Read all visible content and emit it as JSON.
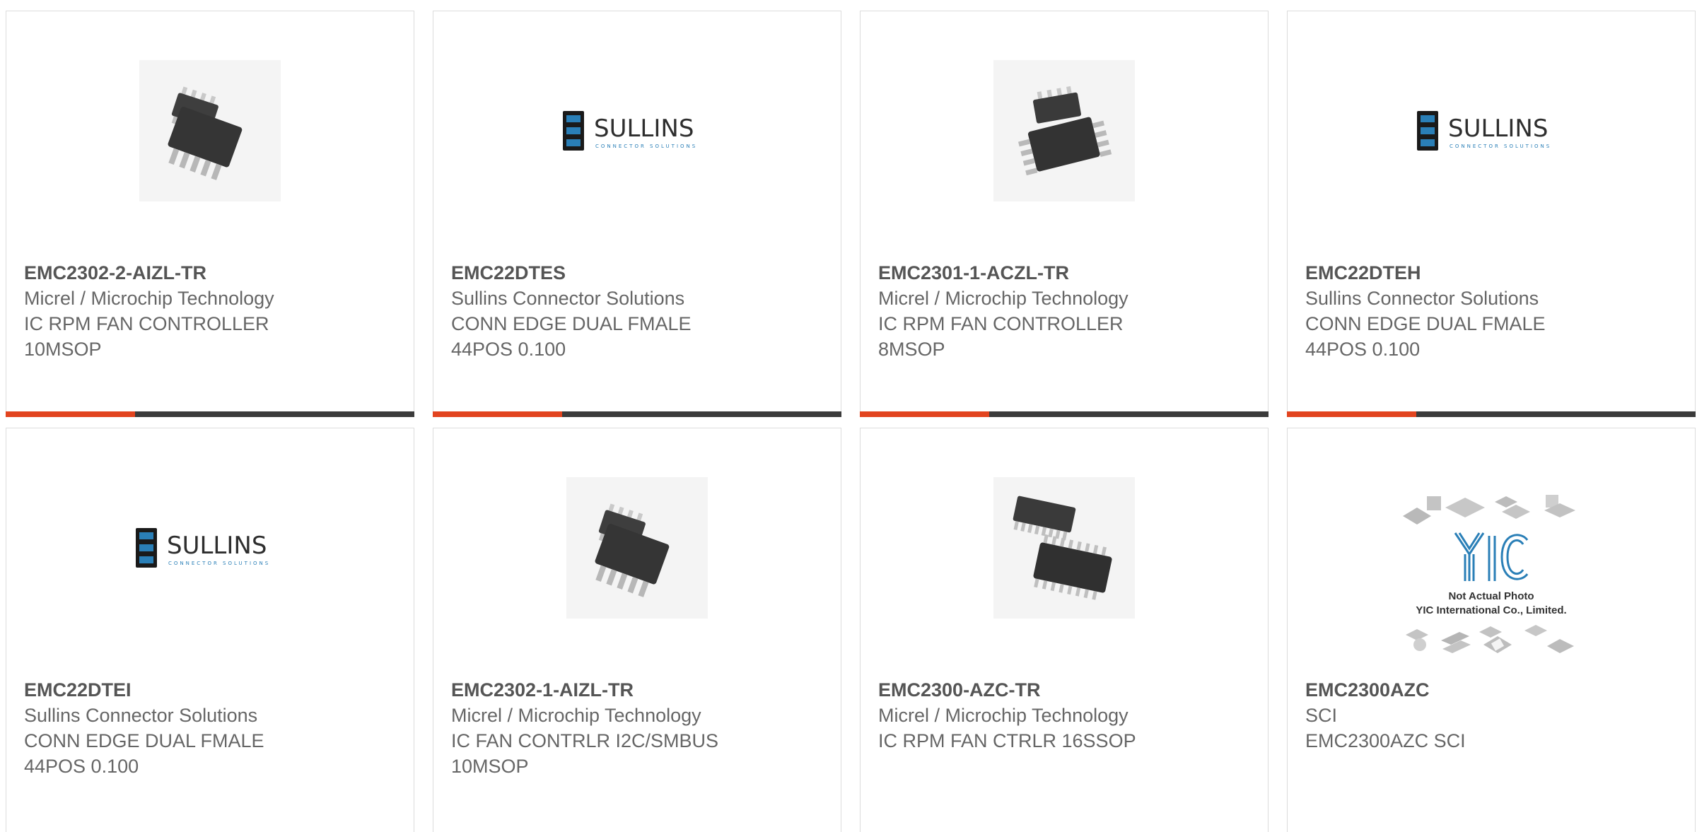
{
  "colors": {
    "accent_orange": "#e2441f",
    "bar_dark": "#3b3b3b",
    "sullins_blue": "#2a7fb7"
  },
  "products": [
    {
      "part": "EMC2302-2-AIZL-TR",
      "maker": "Micrel / Microchip Technology",
      "desc1": "IC RPM FAN CONTROLLER",
      "desc2": "10MSOP",
      "image": "msop-chip-photo"
    },
    {
      "part": "EMC22DTES",
      "maker": "Sullins Connector Solutions",
      "desc1": "CONN EDGE DUAL FMALE",
      "desc2": "44POS 0.100",
      "image": "sullins-logo"
    },
    {
      "part": "EMC2301-1-ACZL-TR",
      "maker": "Micrel / Microchip Technology",
      "desc1": "IC RPM FAN CONTROLLER",
      "desc2": "8MSOP",
      "image": "msop-chip-photo"
    },
    {
      "part": "EMC22DTEH",
      "maker": "Sullins Connector Solutions",
      "desc1": "CONN EDGE DUAL FMALE",
      "desc2": "44POS 0.100",
      "image": "sullins-logo"
    },
    {
      "part": "EMC22DTEI",
      "maker": "Sullins Connector Solutions",
      "desc1": "CONN EDGE DUAL FMALE",
      "desc2": "44POS 0.100",
      "image": "sullins-logo"
    },
    {
      "part": "EMC2302-1-AIZL-TR",
      "maker": "Micrel / Microchip Technology",
      "desc1": "IC FAN CONTRLR I2C/SMBUS",
      "desc2": "10MSOP",
      "image": "msop-chip-photo"
    },
    {
      "part": "EMC2300-AZC-TR",
      "maker": "Micrel / Microchip Technology",
      "desc1": "IC RPM FAN CTRLR 16SSOP",
      "desc2": "",
      "image": "ssop-chip-photo"
    },
    {
      "part": "EMC2300AZC",
      "maker": "SCI",
      "desc1": "EMC2300AZC SCI",
      "desc2": "",
      "image": "yic-placeholder"
    }
  ],
  "logos": {
    "sullins_main": "SULLINS",
    "sullins_sub": "CONNECTOR SOLUTIONS",
    "yic_mark": "YIC",
    "yic_line1": "Not Actual Photo",
    "yic_line2": "YIC International Co., Limited."
  }
}
